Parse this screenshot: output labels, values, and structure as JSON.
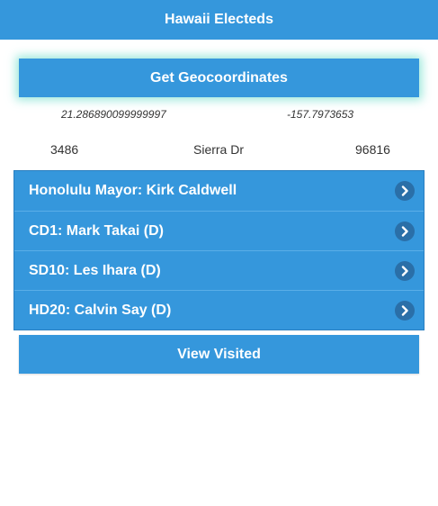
{
  "header": {
    "title": "Hawaii Electeds"
  },
  "geocode": {
    "button_label": "Get Geocoordinates",
    "latitude": "21.286890099999997",
    "longitude": "-157.7973653"
  },
  "address": {
    "number": "3486",
    "street": "Sierra Dr",
    "zip": "96816"
  },
  "officials": [
    {
      "label": "Honolulu Mayor: Kirk Caldwell"
    },
    {
      "label": "CD1: Mark Takai (D)"
    },
    {
      "label": "SD10: Les Ihara (D)"
    },
    {
      "label": "HD20: Calvin Say (D)"
    }
  ],
  "footer": {
    "visited_label": "View Visited"
  },
  "colors": {
    "primary": "#3597dc",
    "chevron_bg": "#2a6fa8",
    "glow": "#64dcc8"
  },
  "icons": {
    "list_chevron": "chevron-right-icon"
  }
}
